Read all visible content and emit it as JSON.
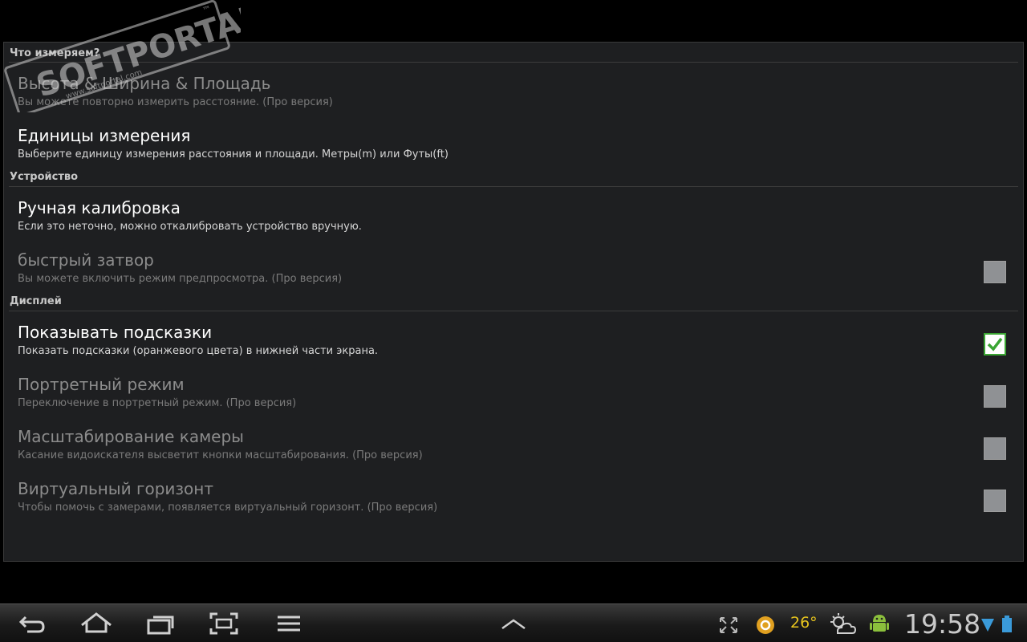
{
  "settings": {
    "sections": {
      "measure": "Что измеряем?",
      "device": "Устройство",
      "display": "Дисплей"
    },
    "items": [
      {
        "title": "Высота & Ширина & Площадь",
        "subtitle": "Вы можете повторно измерить расстояние. (Про версия)",
        "enabled": false
      },
      {
        "title": "Единицы измерения",
        "subtitle": "Выберите единицу измерения расстояния и площади. Метры(m) или Футы(ft)",
        "enabled": true
      },
      {
        "title": "Ручная калибровка",
        "subtitle": "Если это неточно, можно откалибровать устройство вручную.",
        "enabled": true
      },
      {
        "title": "быстрый затвор",
        "subtitle": "Вы можете включить режим предпросмотра. (Про версия)",
        "enabled": false,
        "checked": false
      },
      {
        "title": "Показывать подсказки",
        "subtitle": "Показать подсказки (оранжевого цвета) в нижней части экрана.",
        "enabled": true,
        "checked": true
      },
      {
        "title": "Портретный режим",
        "subtitle": "Переключение в портретный режим. (Про версия)",
        "enabled": false,
        "checked": false
      },
      {
        "title": "Масштабирование камеры",
        "subtitle": "Касание видоискателя высветит кнопки масштабирования. (Про версия)",
        "enabled": false,
        "checked": false
      },
      {
        "title": "Виртуальный горизонт",
        "subtitle": "Чтобы помочь с замерами, появляется виртуальный горизонт. (Про версия)",
        "enabled": false,
        "checked": false
      }
    ]
  },
  "watermark": {
    "brand": "SOFTPORTAL",
    "tm": "™",
    "url": "www.softportal.com"
  },
  "statusbar": {
    "temperature": "26°",
    "time": "19:58",
    "icons": [
      "back-icon",
      "home-icon",
      "recent-apps-icon",
      "screenshot-icon",
      "menu-icon",
      "chevron-up-icon",
      "fullscreen-icon",
      "notification-app-icon",
      "weather-icon",
      "android-icon",
      "wifi-icon",
      "battery-icon"
    ]
  },
  "colors": {
    "background": "#1e1f21",
    "checkbox_checked": "#3aa533",
    "temperature": "#e8c51e"
  }
}
